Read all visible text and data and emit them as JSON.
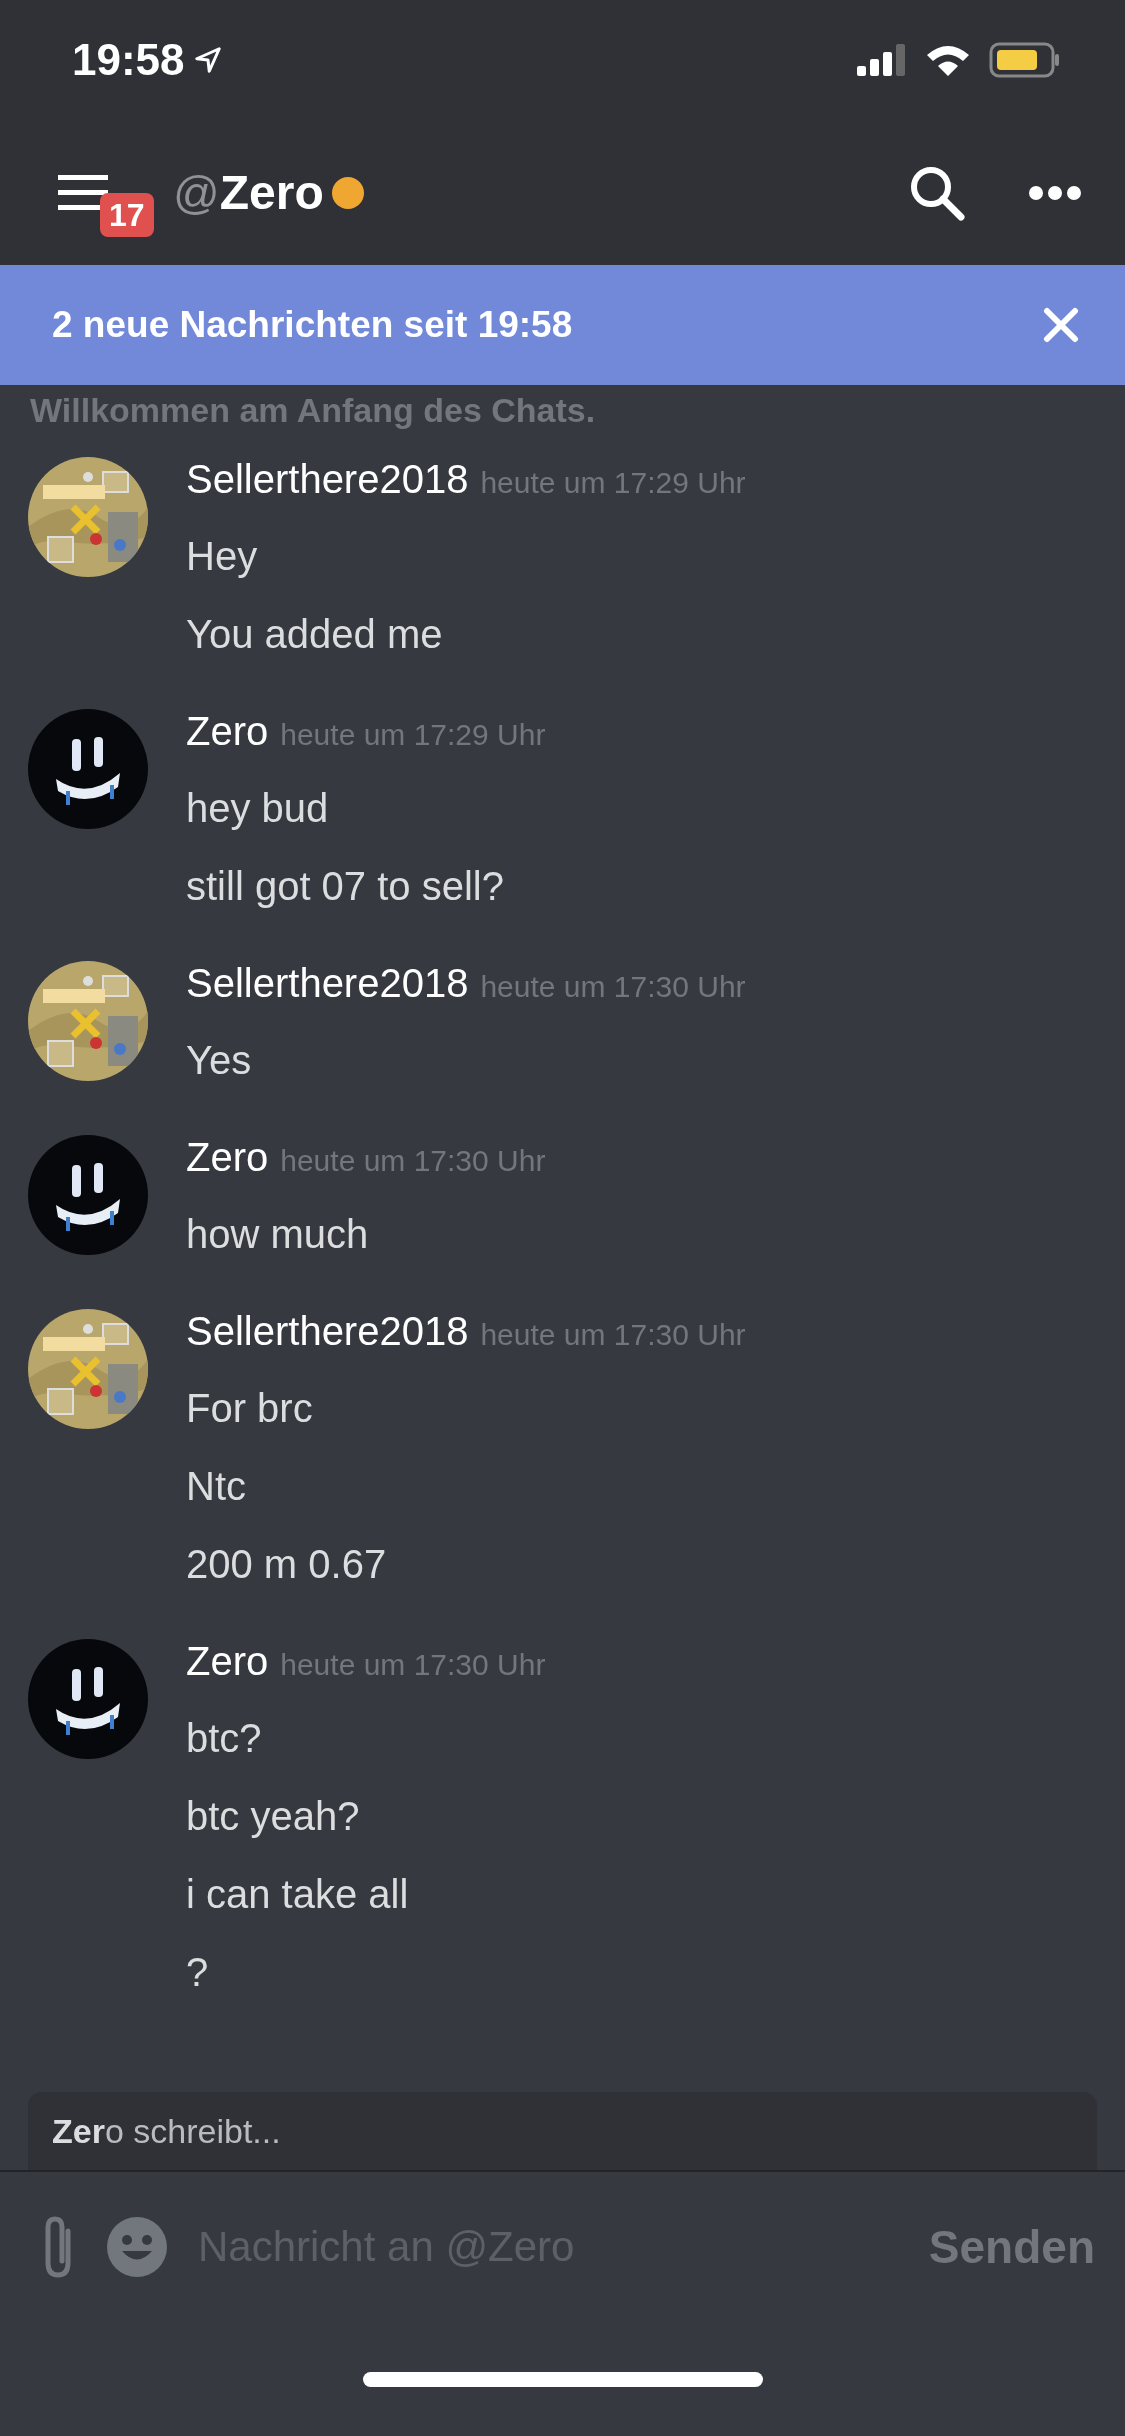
{
  "status_bar": {
    "time": "19:58"
  },
  "header": {
    "badge": "17",
    "at": "@",
    "name": "Zero",
    "idle": true
  },
  "banner": {
    "text": "2 neue Nachrichten seit 19:58"
  },
  "welcome": "Willkommen am Anfang des Chats.",
  "messages": [
    {
      "kind": "map",
      "author": "Sellerthere2018",
      "time": "heute um 17:29 Uhr",
      "lines": [
        "Hey",
        "You added me"
      ]
    },
    {
      "kind": "dark",
      "author": "Zero",
      "time": "heute um 17:29 Uhr",
      "lines": [
        "hey bud",
        "still got 07 to sell?"
      ]
    },
    {
      "kind": "map",
      "author": "Sellerthere2018",
      "time": "heute um 17:30 Uhr",
      "lines": [
        "Yes"
      ]
    },
    {
      "kind": "dark",
      "author": "Zero",
      "time": "heute um 17:30 Uhr",
      "lines": [
        "how much"
      ]
    },
    {
      "kind": "map",
      "author": "Sellerthere2018",
      "time": "heute um 17:30 Uhr",
      "lines": [
        "For brc",
        "Ntc",
        "200 m 0.67"
      ]
    },
    {
      "kind": "dark",
      "author": "Zero",
      "time": "heute um 17:30 Uhr",
      "lines": [
        "btc?",
        "btc yeah?",
        "i can take all",
        "?"
      ]
    }
  ],
  "typing": "**Zer**o schreibt...",
  "composer": {
    "placeholder": "Nachricht an @Zero",
    "send": "Senden"
  }
}
